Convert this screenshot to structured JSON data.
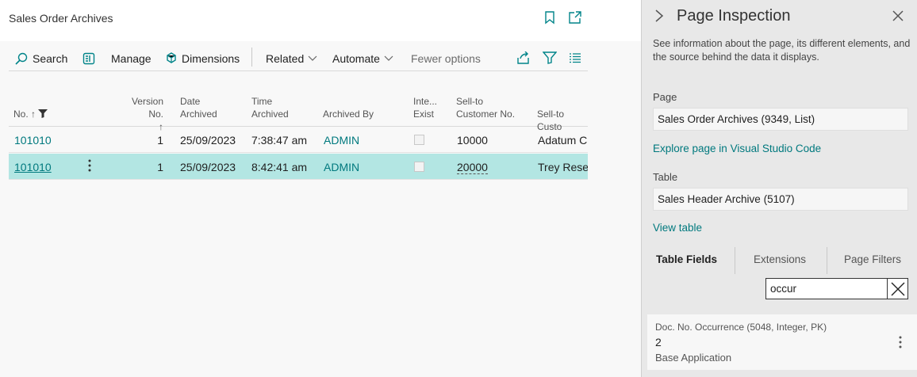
{
  "page": {
    "title": "Sales Order Archives"
  },
  "toolbar": {
    "search": "Search",
    "manage": "Manage",
    "dimensions": "Dimensions",
    "related": "Related",
    "automate": "Automate",
    "fewer_options": "Fewer options"
  },
  "grid": {
    "headers": {
      "no": "No. ↑",
      "version_no": "Version No.",
      "version_sort": "↑",
      "date_archived_1": "Date",
      "date_archived_2": "Archived",
      "time_archived_1": "Time",
      "time_archived_2": "Archived",
      "archived_by": "Archived By",
      "inte_exist_1": "Inte...",
      "inte_exist_2": "Exist",
      "sell_to_1": "Sell-to",
      "sell_to_2": "Customer No.",
      "sell_to_name": "Sell-to Custo"
    },
    "rows": [
      {
        "no": "101010",
        "version": "1",
        "date": "25/09/2023",
        "time": "7:38:47 am",
        "by": "ADMIN",
        "cust_no": "10000",
        "cust_name": "Adatum C"
      },
      {
        "no": "101010",
        "version": "1",
        "date": "25/09/2023",
        "time": "8:42:41 am",
        "by": "ADMIN",
        "cust_no": "20000",
        "cust_name": "Trey Resea"
      }
    ]
  },
  "inspection": {
    "title": "Page Inspection",
    "description": "See information about the page, its different elements, and the source behind the data it displays.",
    "page_label": "Page",
    "page_value": "Sales Order Archives (9349, List)",
    "explore_link": "Explore page in Visual Studio Code",
    "table_label": "Table",
    "table_value": "Sales Header Archive (5107)",
    "view_table_link": "View table",
    "tabs": [
      "Table Fields",
      "Extensions",
      "Page Filters"
    ],
    "search_value": "occur",
    "field": {
      "name": "Doc. No. Occurrence (5048, Integer, PK)",
      "value": "2",
      "source": "Base Application"
    }
  },
  "colors": {
    "accent": "#008489",
    "selected_row": "#b3e6e3",
    "panel_bg": "#e8e8e8"
  }
}
